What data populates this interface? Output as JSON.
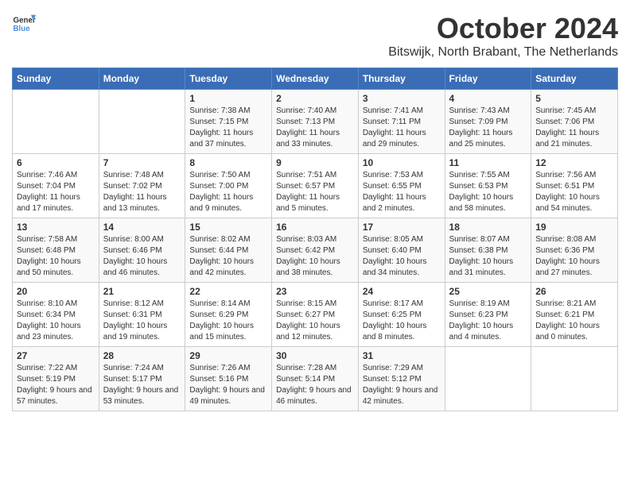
{
  "header": {
    "logo_line1": "General",
    "logo_line2": "Blue",
    "month_title": "October 2024",
    "subtitle": "Bitswijk, North Brabant, The Netherlands"
  },
  "days_of_week": [
    "Sunday",
    "Monday",
    "Tuesday",
    "Wednesday",
    "Thursday",
    "Friday",
    "Saturday"
  ],
  "weeks": [
    [
      {
        "day": "",
        "info": ""
      },
      {
        "day": "",
        "info": ""
      },
      {
        "day": "1",
        "info": "Sunrise: 7:38 AM\nSunset: 7:15 PM\nDaylight: 11 hours and 37 minutes."
      },
      {
        "day": "2",
        "info": "Sunrise: 7:40 AM\nSunset: 7:13 PM\nDaylight: 11 hours and 33 minutes."
      },
      {
        "day": "3",
        "info": "Sunrise: 7:41 AM\nSunset: 7:11 PM\nDaylight: 11 hours and 29 minutes."
      },
      {
        "day": "4",
        "info": "Sunrise: 7:43 AM\nSunset: 7:09 PM\nDaylight: 11 hours and 25 minutes."
      },
      {
        "day": "5",
        "info": "Sunrise: 7:45 AM\nSunset: 7:06 PM\nDaylight: 11 hours and 21 minutes."
      }
    ],
    [
      {
        "day": "6",
        "info": "Sunrise: 7:46 AM\nSunset: 7:04 PM\nDaylight: 11 hours and 17 minutes."
      },
      {
        "day": "7",
        "info": "Sunrise: 7:48 AM\nSunset: 7:02 PM\nDaylight: 11 hours and 13 minutes."
      },
      {
        "day": "8",
        "info": "Sunrise: 7:50 AM\nSunset: 7:00 PM\nDaylight: 11 hours and 9 minutes."
      },
      {
        "day": "9",
        "info": "Sunrise: 7:51 AM\nSunset: 6:57 PM\nDaylight: 11 hours and 5 minutes."
      },
      {
        "day": "10",
        "info": "Sunrise: 7:53 AM\nSunset: 6:55 PM\nDaylight: 11 hours and 2 minutes."
      },
      {
        "day": "11",
        "info": "Sunrise: 7:55 AM\nSunset: 6:53 PM\nDaylight: 10 hours and 58 minutes."
      },
      {
        "day": "12",
        "info": "Sunrise: 7:56 AM\nSunset: 6:51 PM\nDaylight: 10 hours and 54 minutes."
      }
    ],
    [
      {
        "day": "13",
        "info": "Sunrise: 7:58 AM\nSunset: 6:48 PM\nDaylight: 10 hours and 50 minutes."
      },
      {
        "day": "14",
        "info": "Sunrise: 8:00 AM\nSunset: 6:46 PM\nDaylight: 10 hours and 46 minutes."
      },
      {
        "day": "15",
        "info": "Sunrise: 8:02 AM\nSunset: 6:44 PM\nDaylight: 10 hours and 42 minutes."
      },
      {
        "day": "16",
        "info": "Sunrise: 8:03 AM\nSunset: 6:42 PM\nDaylight: 10 hours and 38 minutes."
      },
      {
        "day": "17",
        "info": "Sunrise: 8:05 AM\nSunset: 6:40 PM\nDaylight: 10 hours and 34 minutes."
      },
      {
        "day": "18",
        "info": "Sunrise: 8:07 AM\nSunset: 6:38 PM\nDaylight: 10 hours and 31 minutes."
      },
      {
        "day": "19",
        "info": "Sunrise: 8:08 AM\nSunset: 6:36 PM\nDaylight: 10 hours and 27 minutes."
      }
    ],
    [
      {
        "day": "20",
        "info": "Sunrise: 8:10 AM\nSunset: 6:34 PM\nDaylight: 10 hours and 23 minutes."
      },
      {
        "day": "21",
        "info": "Sunrise: 8:12 AM\nSunset: 6:31 PM\nDaylight: 10 hours and 19 minutes."
      },
      {
        "day": "22",
        "info": "Sunrise: 8:14 AM\nSunset: 6:29 PM\nDaylight: 10 hours and 15 minutes."
      },
      {
        "day": "23",
        "info": "Sunrise: 8:15 AM\nSunset: 6:27 PM\nDaylight: 10 hours and 12 minutes."
      },
      {
        "day": "24",
        "info": "Sunrise: 8:17 AM\nSunset: 6:25 PM\nDaylight: 10 hours and 8 minutes."
      },
      {
        "day": "25",
        "info": "Sunrise: 8:19 AM\nSunset: 6:23 PM\nDaylight: 10 hours and 4 minutes."
      },
      {
        "day": "26",
        "info": "Sunrise: 8:21 AM\nSunset: 6:21 PM\nDaylight: 10 hours and 0 minutes."
      }
    ],
    [
      {
        "day": "27",
        "info": "Sunrise: 7:22 AM\nSunset: 5:19 PM\nDaylight: 9 hours and 57 minutes."
      },
      {
        "day": "28",
        "info": "Sunrise: 7:24 AM\nSunset: 5:17 PM\nDaylight: 9 hours and 53 minutes."
      },
      {
        "day": "29",
        "info": "Sunrise: 7:26 AM\nSunset: 5:16 PM\nDaylight: 9 hours and 49 minutes."
      },
      {
        "day": "30",
        "info": "Sunrise: 7:28 AM\nSunset: 5:14 PM\nDaylight: 9 hours and 46 minutes."
      },
      {
        "day": "31",
        "info": "Sunrise: 7:29 AM\nSunset: 5:12 PM\nDaylight: 9 hours and 42 minutes."
      },
      {
        "day": "",
        "info": ""
      },
      {
        "day": "",
        "info": ""
      }
    ]
  ]
}
